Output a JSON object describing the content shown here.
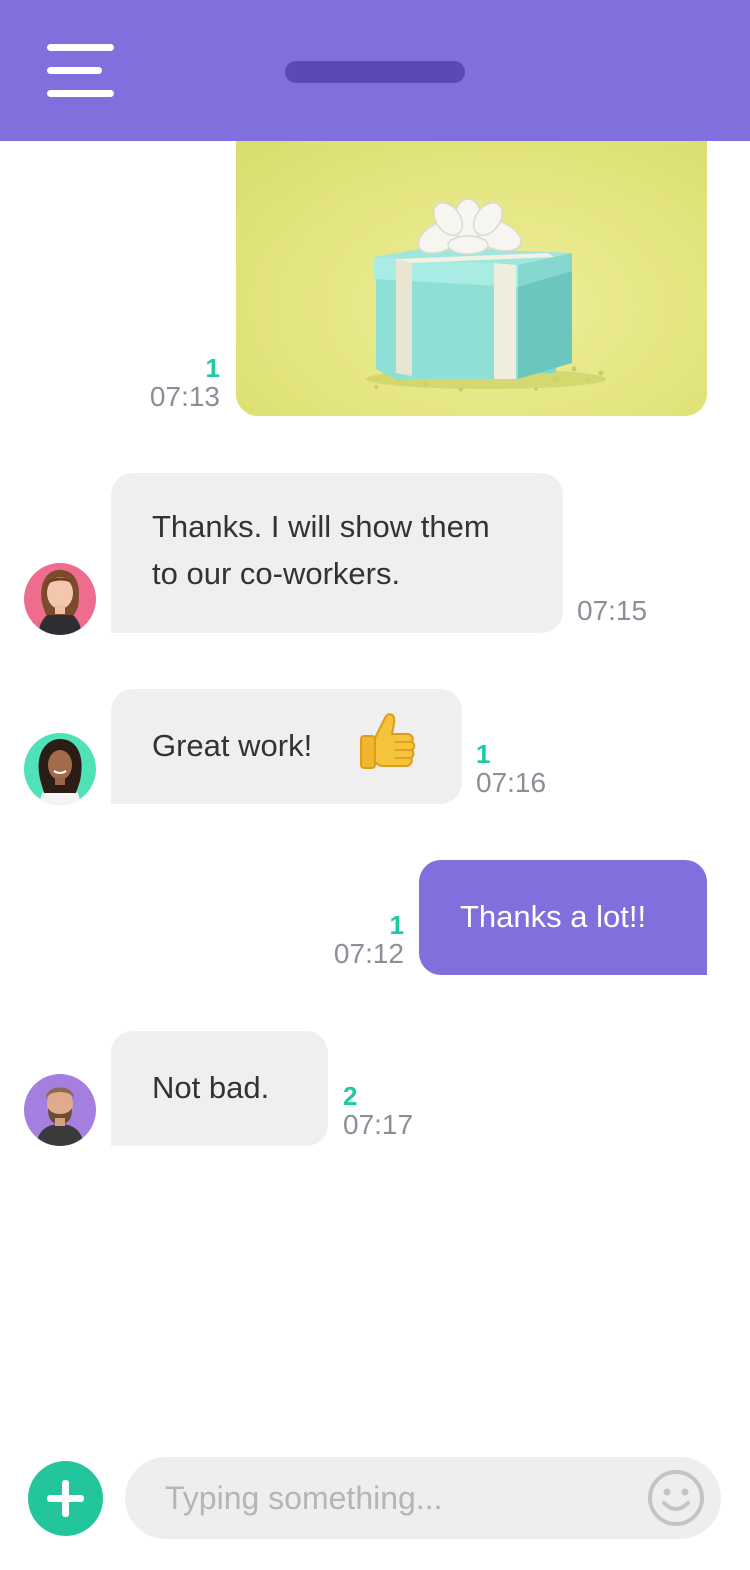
{
  "header": {
    "menu_icon": "hamburger-menu-icon"
  },
  "messages": [
    {
      "type": "image",
      "direction": "outgoing",
      "image_desc": "gift-box",
      "read_count": "1",
      "time": "07:13"
    },
    {
      "type": "text",
      "direction": "incoming",
      "lines": [
        "Thanks. I will show them",
        "to our co-workers."
      ],
      "time": "07:15",
      "avatar": "avatar-woman-pink-background"
    },
    {
      "type": "text",
      "direction": "incoming",
      "text": "Great work!",
      "emoji": "thumbs-up-icon",
      "read_count": "1",
      "time": "07:16",
      "avatar": "avatar-woman-green-background"
    },
    {
      "type": "text",
      "direction": "outgoing",
      "text": "Thanks a lot!!",
      "read_count": "1",
      "time": "07:12"
    },
    {
      "type": "text",
      "direction": "incoming",
      "text": "Not bad.",
      "read_count": "2",
      "time": "07:17",
      "avatar": "avatar-man-purple-background"
    }
  ],
  "composer": {
    "placeholder": "Typing something...",
    "add_icon": "plus-icon",
    "emoji_icon": "smiley-icon"
  },
  "colors": {
    "accent": "#8070de",
    "header_pill": "#5c49b8",
    "read_count": "#1fc9a3",
    "add_button": "#22c59c",
    "incoming_bubble": "#efefef"
  }
}
